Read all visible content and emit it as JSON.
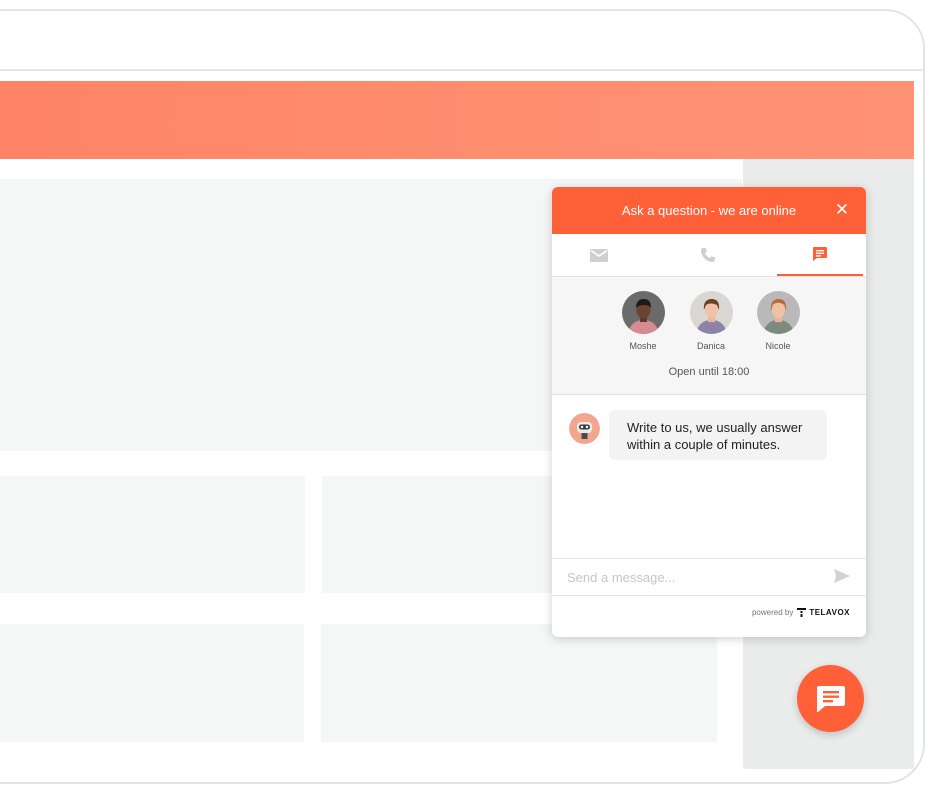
{
  "chat": {
    "header_title": "Ask a question - we are online",
    "close_symbol": "✕",
    "tabs": [
      {
        "name": "email",
        "icon": "mail-icon",
        "active": false
      },
      {
        "name": "phone",
        "icon": "phone-icon",
        "active": false
      },
      {
        "name": "chat",
        "icon": "chat-icon",
        "active": true
      }
    ],
    "agents": [
      {
        "name": "Moshe"
      },
      {
        "name": "Danica"
      },
      {
        "name": "Nicole"
      }
    ],
    "open_hours": "Open until 18:00",
    "welcome_message": "Write to us, we usually answer within a couple of minutes.",
    "input_placeholder": "Send a message...",
    "powered_by_label": "powered by",
    "brand_name": "TELAVOX"
  },
  "colors": {
    "accent": "#ff6038",
    "banner": "#ff8e6f",
    "placeholder_block": "#f5f6f6",
    "side_column": "#eaebeb"
  }
}
